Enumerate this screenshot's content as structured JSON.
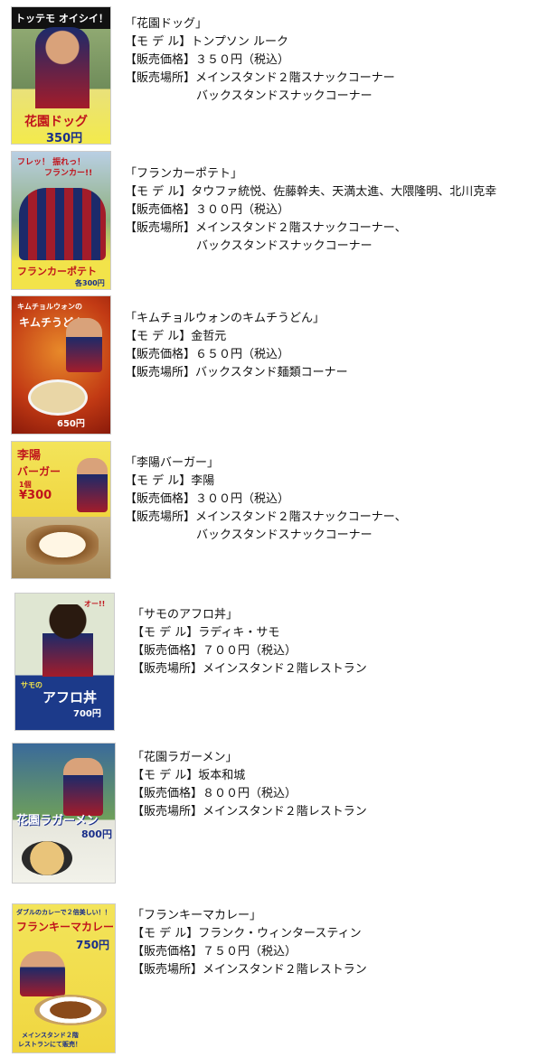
{
  "labels": {
    "model": "【モ デ ル】",
    "price": "【販売価格】",
    "place": "【販売場所】"
  },
  "items": [
    {
      "name": "「花園ドッグ」",
      "model": "トンプソン ルーク",
      "price": "３５０円（税込）",
      "place": "メインスタンド２階スナックコーナー",
      "place2": "バックスタンドスナックコーナー",
      "poster_text": [
        "トッテモ オイシイ！",
        "花園ドッグ",
        "350円"
      ]
    },
    {
      "name": "「フランカーポテト」",
      "model": "タウファ統悦、佐藤幹夫、天満太進、大隈隆明、北川克幸",
      "price": "３００円（税込）",
      "place": "メインスタンド２階スナックコーナー、",
      "place2": "バックスタンドスナックコーナー",
      "poster_text": [
        "フレッ！ 振れっ！",
        "フランカー!!",
        "フランカーポテト",
        "各300円"
      ]
    },
    {
      "name": "「キムチョルウォンのキムチうどん」",
      "model": "金哲元",
      "price": "６５０円（税込）",
      "place": "バックスタンド麺類コーナー",
      "poster_text": [
        "キムチョルウォンの",
        "キムチうどん",
        "650円"
      ]
    },
    {
      "name": "「李陽バーガー」",
      "model": "李陽",
      "price": "３００円（税込）",
      "place": "メインスタンド２階スナックコーナー、",
      "place2": "バックスタンドスナックコーナー",
      "poster_text": [
        "李陽",
        "バーガー",
        "1個",
        "¥300"
      ]
    },
    {
      "name": "「サモのアフロ丼」",
      "model": "ラディキ・サモ",
      "price": "７００円（税込）",
      "place": "メインスタンド２階レストラン",
      "poster_text": [
        "オー!!",
        "サモの",
        "アフロ丼",
        "700円"
      ]
    },
    {
      "name": "「花園ラガーメン」",
      "model": "坂本和城",
      "price": "８００円（税込）",
      "place": "メインスタンド２階レストラン",
      "poster_text": [
        "花園ラガーメン",
        "800円"
      ]
    },
    {
      "name": "「フランキーマカレー」",
      "model": "フランク・ウィンタースティン",
      "price": "７５０円（税込）",
      "place": "メインスタンド２階レストラン",
      "poster_text": [
        "ダブルのカレーで２倍美しい！！",
        "フランキーマカレー",
        "750円",
        "メインスタンド２階",
        "レストランにて販売！"
      ]
    }
  ]
}
